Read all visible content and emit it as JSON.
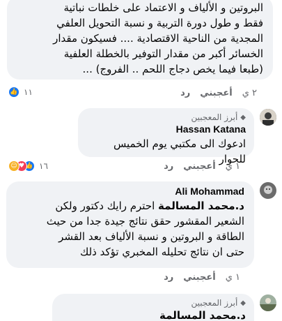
{
  "comment1": {
    "lines": [
      "البروتين و الألياف و الاعتماد على خلطات نباتية",
      "فقط و طول دورة التربية و نسبة التحويل العلفي",
      "المجدية من الناحية الاقتصادية .... فسيكون مقدار",
      "الخسائر أكبر من مقدار التوفير بالخطلة العلفية",
      "(طبعا فيما يخص دجاج اللحم .. الفروج) ..."
    ],
    "time": "٢ ي",
    "like": "أعجبني",
    "reply": "رد",
    "reaction_count": "١١"
  },
  "comment2": {
    "badge": "أبرز المعجبين",
    "author": "Hassan Katana",
    "text": "ادعوك الى مكتبي يوم الخميس للحوار",
    "time": "١ ي",
    "like": "أعجبني",
    "reply": "رد",
    "reaction_count": "١٦"
  },
  "comment3": {
    "author": "Ali Mohammad",
    "mention": "د.محمد المسالمة",
    "first_line_rest": " احترم رايك دكتور ولكن",
    "lines": [
      "الشعير المقشور حقق نتائج جيدة جدا من حيث",
      "الطاقة و البروتين و نسبة الألياف بعد القشر",
      "حتى ان نتائج تحليله المخبري تؤكد ذلك"
    ],
    "time": "١ ي",
    "like": "أعجبني",
    "reply": "رد"
  },
  "comment4": {
    "badge": "أبرز المعجبين",
    "mention": "د.محمد المسالمة"
  },
  "icons": {
    "like": "thumbs-up-icon",
    "love": "heart-icon",
    "care": "care-icon",
    "badge": "diamond-icon"
  }
}
